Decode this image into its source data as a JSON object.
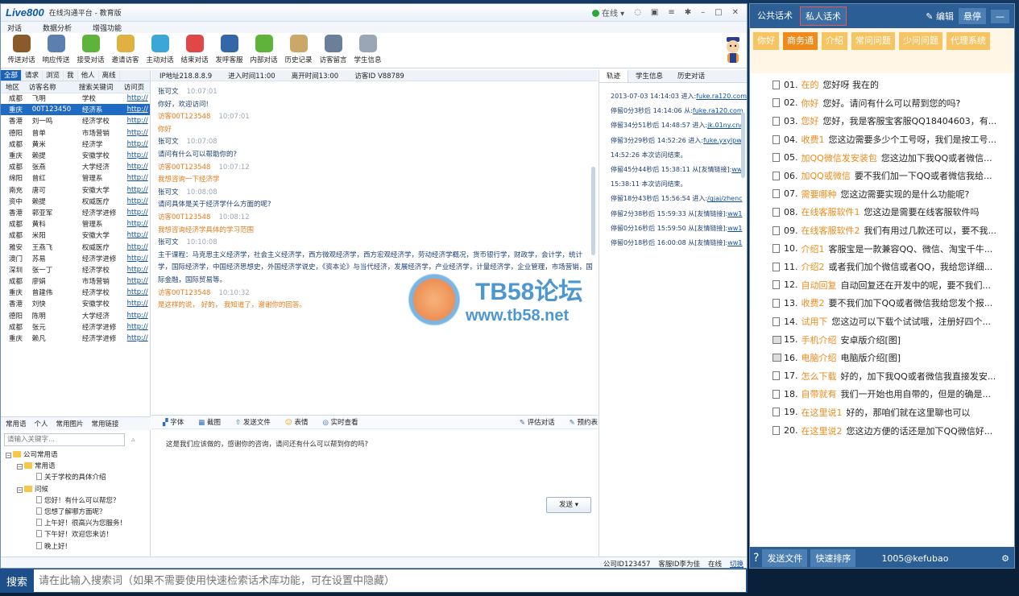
{
  "app": {
    "logo": "Live800",
    "subtitle": "在线沟通平台 - 教育版",
    "status": "在线"
  },
  "menu": [
    "对话",
    "数据分析",
    "增强功能"
  ],
  "toolbar": [
    {
      "label": "传送对话",
      "color": "#8b5a2b"
    },
    {
      "label": "响应传送",
      "color": "#5a7fb0"
    },
    {
      "label": "接受对话",
      "color": "#5fb33a"
    },
    {
      "label": "邀请访客",
      "color": "#e0b040"
    },
    {
      "label": "主动对话",
      "color": "#3aa7d8"
    },
    {
      "label": "结束对话",
      "color": "#e04848"
    },
    {
      "label": "发呼客服",
      "color": "#3466a8"
    },
    {
      "label": "内部对话",
      "color": "#5fb33a"
    },
    {
      "label": "历史记录",
      "color": "#c9a86a"
    },
    {
      "label": "访客留言",
      "color": "#6a7f9a"
    },
    {
      "label": "学生信息",
      "color": "#9aa6b6"
    }
  ],
  "left": {
    "tabs": [
      "全部",
      "请求",
      "浏览",
      "我",
      "他人",
      "离线"
    ],
    "columns": [
      "地区",
      "访客名称",
      "搜索关键词",
      "访问页"
    ],
    "rows": [
      [
        "成都",
        "飞明",
        "学校",
        "http://"
      ],
      [
        "重庆",
        "00T123450",
        "经济系",
        "http://"
      ],
      [
        "香港",
        "刘一鸣",
        "经济学校",
        "http://"
      ],
      [
        "德阳",
        "曾单",
        "市场营销",
        "http://"
      ],
      [
        "成都",
        "黄米",
        "经济学",
        "http://"
      ],
      [
        "重庆",
        "赖提",
        "安徽学校",
        "http://"
      ],
      [
        "成都",
        "张燕",
        "大学经济",
        "http://"
      ],
      [
        "绵阳",
        "曾红",
        "管理系",
        "http://"
      ],
      [
        "南充",
        "唐可",
        "安徽大学",
        "http://"
      ],
      [
        "资中",
        "赖提",
        "权威医疗",
        "http://"
      ],
      [
        "香港",
        "郭亚军",
        "经济学进修",
        "http://"
      ],
      [
        "成都",
        "黄科",
        "管理系",
        "http://"
      ],
      [
        "成都",
        "米阳",
        "安徽大学",
        "http://"
      ],
      [
        "雅安",
        "王燕飞",
        "权威医疗",
        "http://"
      ],
      [
        "澳门",
        "苏易",
        "经济学进修",
        "http://"
      ],
      [
        "深圳",
        "张一丁",
        "经济学校",
        "http://"
      ],
      [
        "成都",
        "廖娟",
        "市场营销",
        "http://"
      ],
      [
        "重庆",
        "曾建伟",
        "经济学校",
        "http://"
      ],
      [
        "香港",
        "刘快",
        "安徽学校",
        "http://"
      ],
      [
        "德阳",
        "陈明",
        "大学经济",
        "http://"
      ],
      [
        "成都",
        "张元",
        "经济学进修",
        "http://"
      ],
      [
        "重庆",
        "赖凡",
        "经济学进修",
        "http://"
      ]
    ],
    "selected_row": 1,
    "phrase_tabs": [
      "常用语",
      "个人",
      "常用图片",
      "常用链接"
    ],
    "phrase_search_placeholder": "请输入关键字...",
    "tree": [
      "公司常用语",
      "常用语",
      "关于学校的具体介绍",
      "问候",
      "您好！有什么可以帮您？",
      "您想了解哪方面呢？",
      "上午好！很高兴为您服务！",
      "下午好！欢迎您来访！",
      "晚上好!"
    ]
  },
  "center": {
    "info": [
      "IP地址218.8.8.9",
      "进入时间11:00",
      "离开时间13:00",
      "访客ID  V88789"
    ],
    "messages": [
      {
        "who": "张可文",
        "time": "10:07:01",
        "text": "你好，欢迎访问!",
        "role": "agent"
      },
      {
        "who": "访客00T123548",
        "time": "10:07:01",
        "text": "你好",
        "role": "visitor"
      },
      {
        "who": "张可文",
        "time": "10:07:08",
        "text": "请问有什么可以帮助你的?",
        "role": "agent"
      },
      {
        "who": "访客00T123548",
        "time": "10:07:12",
        "text": "我想咨询一下经济学",
        "role": "visitor"
      },
      {
        "who": "张可文",
        "time": "10:08:08",
        "text": "请问具体是关于经济学什么方面的呢?",
        "role": "agent"
      },
      {
        "who": "访客00T123548",
        "time": "10:08:12",
        "text": "我想咨询经济学具体的学习范围",
        "role": "visitor"
      },
      {
        "who": "张可文",
        "time": "10:10:08",
        "text": "主干课程：马克思主义经济学，社会主义经济学，西方微观经济学，西方宏观经济学，劳动经济学概况，货币银行学，财政学，会计学，统计学，国际经济学，中国经济思想史，外国经济学说史，《资本论》与当代经济，发展经济学，产业经济学，计量经济学，企业管理，市场营销，国际金融，国际贸易等。",
        "role": "agent"
      },
      {
        "who": "访客00T123548",
        "time": "10:10:32",
        "text": "是这样的说， 好的， 我知道了，谢谢你的回答。",
        "role": "visitor"
      }
    ],
    "tools": [
      "字体",
      "截图",
      "发送文件",
      "表情",
      "实时查看",
      "评估对话",
      "预约表"
    ],
    "input_text": "这是我们应该做的，感谢你的咨询，请问还有什么可以帮到你的吗?",
    "send": "发送"
  },
  "trail": {
    "tabs": [
      "轨迹",
      "学生信息",
      "历史对话"
    ],
    "rows": [
      {
        "text": "2013-07-03 14:14:03 进入:",
        "link": "fuke.ra120.com"
      },
      {
        "text": "停留0分3秒后 14:14:06 从:",
        "link": "fuke.ra120.com"
      },
      {
        "text": "停留34分51秒后 14:48:57 进入:",
        "link": "jk.01ny.cn/"
      },
      {
        "text": "停留3分29秒后 14:52:26 进入:",
        "link": "fuke.yxylpw."
      },
      {
        "text": "14:52:26 本次访问结束。",
        "link": ""
      },
      {
        "text": "停留45分44秒后 15:38:11 从[友情链接]:",
        "link": "ww"
      },
      {
        "text": "15:38:11 本次访问结束。",
        "link": ""
      },
      {
        "text": "停留18分43秒后 15:56:54 进入:",
        "link": "/gjaj/zhenc"
      },
      {
        "text": "停留2分38秒后 15:59:33 从[友情链接]:",
        "link": "ww1"
      },
      {
        "text": "停留0分16秒后 15:59:50 从[友情链接]:",
        "link": "ww1"
      },
      {
        "text": "停留0分18秒后 16:00:08 从[友情链接]:",
        "link": "ww1"
      }
    ]
  },
  "statusbar": {
    "company": "公司ID123457",
    "agent": "客服ID李为佳",
    "state": "在线",
    "link": "切换"
  },
  "search": {
    "label": "搜索",
    "placeholder": "请在此输入搜索词（如果不需要使用快速检索话术库功能，可在设置中隐藏）"
  },
  "speech": {
    "tabs": [
      "公共话术",
      "私人话术"
    ],
    "edit": "编辑",
    "pin": "悬停",
    "min": "—",
    "categories": [
      "你好",
      "商务通",
      "介绍",
      "常问问题",
      "少问问题",
      "代理系统"
    ],
    "active_category": 1,
    "items": [
      {
        "n": "01.",
        "kw": "在的",
        "text": "您好呀  我在的",
        "img": false
      },
      {
        "n": "02.",
        "kw": "你好",
        "text": "您好。请问有什么可以帮到您的吗?",
        "img": false
      },
      {
        "n": "03.",
        "kw": "您好",
        "text": "您好，我是客服宝客服QQ18404603，有...",
        "img": false
      },
      {
        "n": "04.",
        "kw": "收费1",
        "text": "您这边需要多少个工号呀，我们是按工号...",
        "img": false
      },
      {
        "n": "05.",
        "kw": "加QQ微信发安装包",
        "text": "您这边加下我QQ或者微信...",
        "img": false
      },
      {
        "n": "06.",
        "kw": "加QQ或微信",
        "text": "要不我们加一下QQ或者微信我给...",
        "img": false
      },
      {
        "n": "07.",
        "kw": "需要哪种",
        "text": "您这边需要实现的是什么功能呢?",
        "img": false
      },
      {
        "n": "08.",
        "kw": "在线客服软件1",
        "text": "您这边是需要在线客服软件吗",
        "img": false
      },
      {
        "n": "09.",
        "kw": "在线客服软件2",
        "text": "我们有用过几款还可以，要不我...",
        "img": false
      },
      {
        "n": "10.",
        "kw": "介绍1",
        "text": "客服宝是一款兼容QQ、微信、淘宝千牛...",
        "img": false
      },
      {
        "n": "11.",
        "kw": "介绍2",
        "text": "或者我们加个微信或者QQ，我给您详细...",
        "img": false
      },
      {
        "n": "12.",
        "kw": "自动回复",
        "text": "自动回复还在开发中的呢，要不我们...",
        "img": false
      },
      {
        "n": "13.",
        "kw": "收费2",
        "text": "要不我们加下QQ或者微信我给您发个报...",
        "img": false
      },
      {
        "n": "14.",
        "kw": "试用下",
        "text": "您这边可以下载个试试哦，注册好四个...",
        "img": false
      },
      {
        "n": "15.",
        "kw": "手机介绍",
        "text": "安卓版介绍[图]",
        "img": true
      },
      {
        "n": "16.",
        "kw": "电脑介绍",
        "text": "电脑版介绍[图]",
        "img": true
      },
      {
        "n": "17.",
        "kw": "怎么下载",
        "text": "好的，加下我QQ或者微信我直接发安...",
        "img": false
      },
      {
        "n": "18.",
        "kw": "自带就有",
        "text": "我们一开始也用自带的，但是的确是...",
        "img": false
      },
      {
        "n": "19.",
        "kw": "在这里说1",
        "text": "好的，那咱们就在这里聊也可以",
        "img": false
      },
      {
        "n": "20.",
        "kw": "在这里说2",
        "text": "您这边方便的话还是加下QQ微信好...",
        "img": false
      }
    ],
    "footer": {
      "send_file": "发送文件",
      "sort": "快速排序",
      "user": "1005@kefubao"
    }
  },
  "watermark": {
    "title": "TB58论坛",
    "url": "www.tb58.net"
  }
}
